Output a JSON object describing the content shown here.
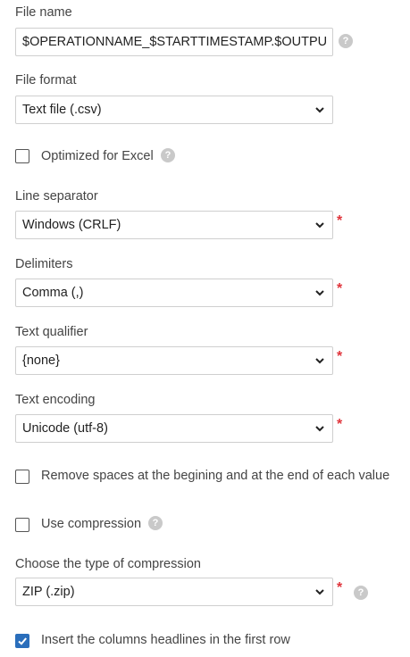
{
  "file_name": {
    "label": "File name",
    "value": "$OPERATIONNAME_$STARTTIMESTAMP.$OUTPUT",
    "help_icon": "question-circle-icon"
  },
  "file_format": {
    "label": "File format",
    "selected": "Text file (.csv)"
  },
  "optimized_for_excel": {
    "label": "Optimized for Excel",
    "checked": false,
    "help_icon": "question-circle-icon"
  },
  "line_separator": {
    "label": "Line separator",
    "selected": "Windows (CRLF)",
    "required_mark": "*"
  },
  "delimiters": {
    "label": "Delimiters",
    "selected": "Comma (,)",
    "required_mark": "*"
  },
  "text_qualifier": {
    "label": "Text qualifier",
    "selected": "{none}",
    "required_mark": "*"
  },
  "text_encoding": {
    "label": "Text encoding",
    "selected": "Unicode (utf-8)",
    "required_mark": "*"
  },
  "remove_spaces": {
    "label": "Remove spaces at the begining and at the end of each value",
    "checked": false
  },
  "use_compression": {
    "label": "Use compression",
    "checked": false,
    "help_icon": "question-circle-icon"
  },
  "compression_type": {
    "label": "Choose the type of compression",
    "selected": "ZIP (.zip)",
    "required_mark": "*",
    "help_icon": "question-circle-icon"
  },
  "insert_headlines": {
    "label": "Insert the columns headlines in the first row",
    "checked": true
  },
  "help_glyph": "?",
  "colors": {
    "required": "#e0343b",
    "checkbox_checked": "#2a6ebb",
    "help_icon_bg": "#c9c9c9",
    "border": "#cfcfcf"
  }
}
